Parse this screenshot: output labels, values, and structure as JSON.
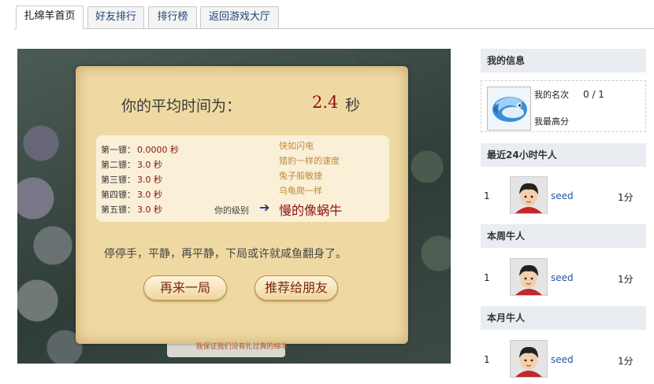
{
  "tabs": [
    {
      "label": "扎绵羊首页",
      "active": true
    },
    {
      "label": "好友排行",
      "active": false
    },
    {
      "label": "排行榜",
      "active": false
    },
    {
      "label": "返回游戏大厅",
      "active": false
    }
  ],
  "game": {
    "avg_label": "你的平均时间为：",
    "avg_value": "2.4",
    "avg_unit": "秒",
    "rounds": [
      {
        "label": "第一镖：",
        "time": "0.0000 秒"
      },
      {
        "label": "第二镖：",
        "time": "3.0 秒"
      },
      {
        "label": "第三镖：",
        "time": "3.0 秒"
      },
      {
        "label": "第四镖：",
        "time": "3.0 秒"
      },
      {
        "label": "第五镖：",
        "time": "3.0 秒"
      }
    ],
    "levels": [
      "快如闪电",
      "猎豹一样的速度",
      "兔子般敏捷",
      "乌龟爬一样"
    ],
    "your_level_label": "你的级别",
    "current_level": "慢的像蜗牛",
    "message": "停停手，平静，再平静，下局或许就咸鱼翻身了。",
    "replay_label": "再来一局",
    "recommend_label": "推荐给朋友",
    "promise": "我保证我们没有扎过真的绵羊"
  },
  "sidebar": {
    "my_info": {
      "title": "我的信息",
      "rank_label": "我的名次",
      "rank_value": "0 / 1",
      "best_label": "我最高分"
    },
    "sections": [
      {
        "title": "最近24小时牛人",
        "rank": "1",
        "name": "seed",
        "score": "1分"
      },
      {
        "title": "本周牛人",
        "rank": "1",
        "name": "seed",
        "score": "1分"
      },
      {
        "title": "本月牛人",
        "rank": "1",
        "name": "seed",
        "score": "1分"
      }
    ]
  },
  "colors": {
    "accent": "#8b1010",
    "link": "#2255aa",
    "panel_header": "#e9ecf1",
    "parchment": "#efd9a3"
  }
}
